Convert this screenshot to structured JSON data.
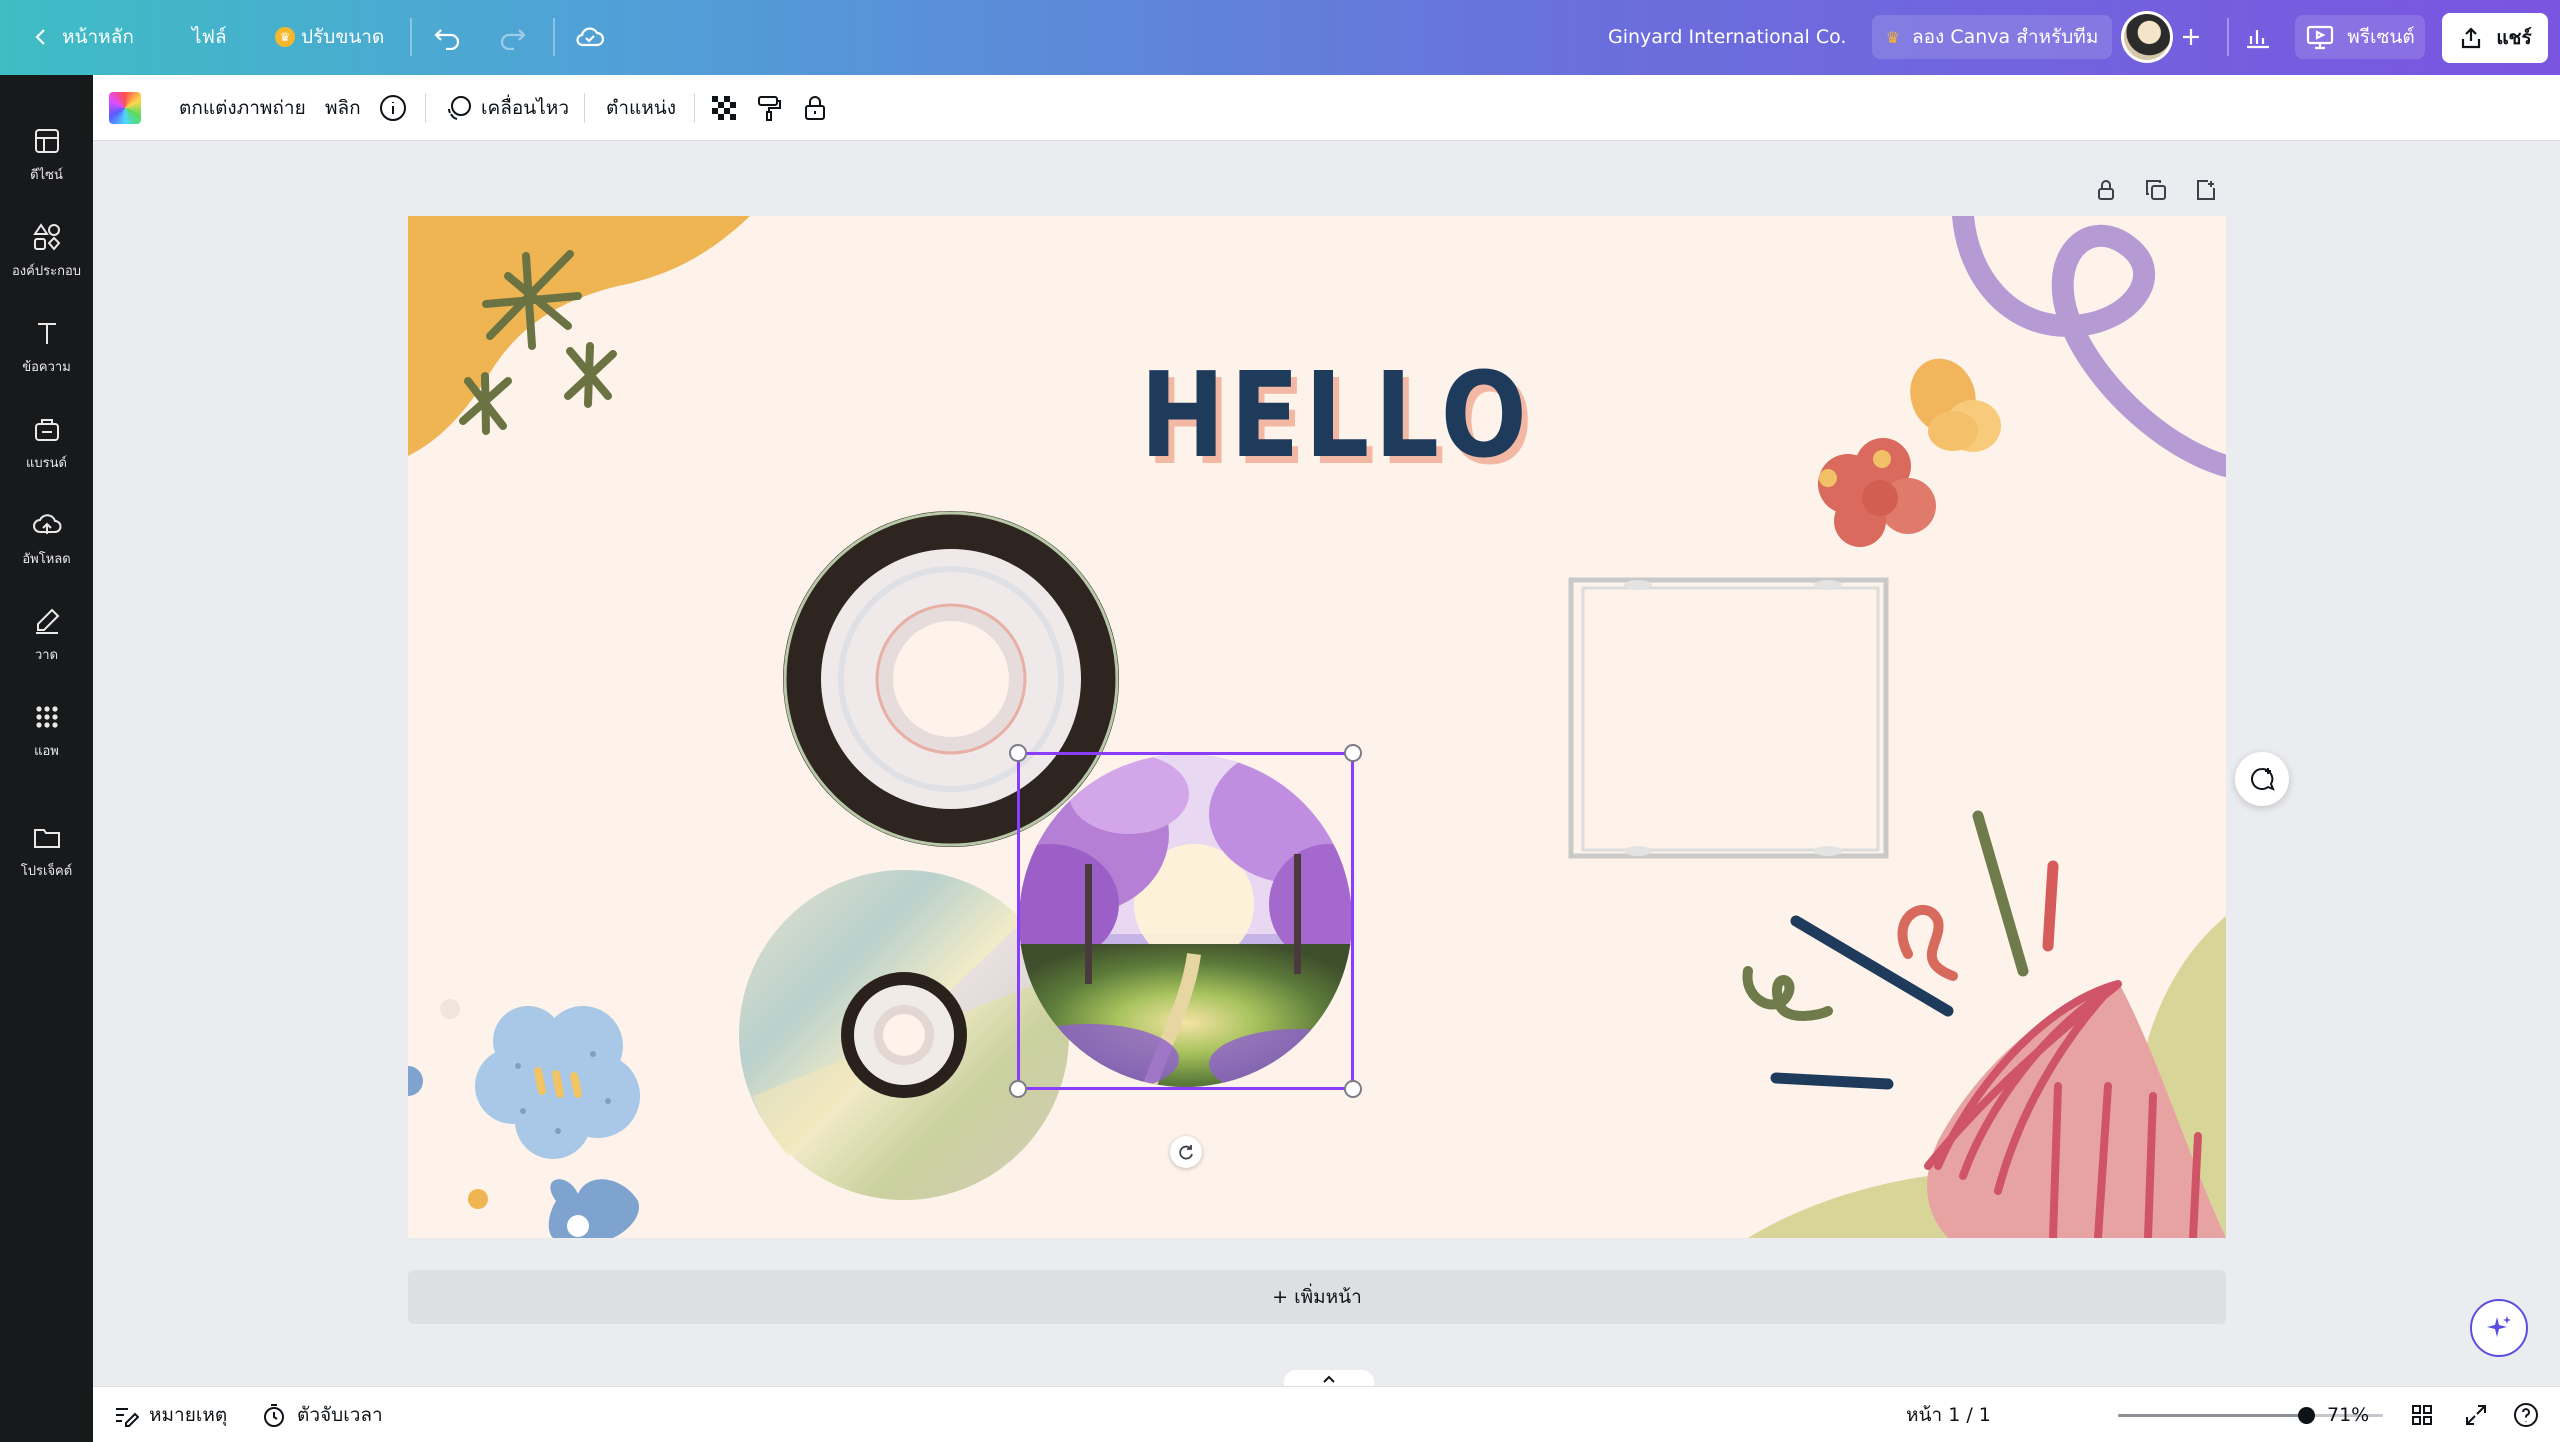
{
  "topbar": {
    "home_label": "หน้าหลัก",
    "file_label": "ไฟล์",
    "resize_label": "ปรับขนาด",
    "team_name": "Ginyard International Co.",
    "try_canva_label": "ลอง Canva สำหรับทีม",
    "present_label": "พรีเซนต์",
    "share_label": "แชร์"
  },
  "rail": {
    "items": [
      {
        "label": "ดีไซน์",
        "icon": "layout-icon"
      },
      {
        "label": "องค์ประกอบ",
        "icon": "shapes-icon"
      },
      {
        "label": "ข้อความ",
        "icon": "text-icon"
      },
      {
        "label": "แบรนด์",
        "icon": "brand-icon"
      },
      {
        "label": "อัพโหลด",
        "icon": "upload-icon"
      },
      {
        "label": "วาด",
        "icon": "draw-icon"
      },
      {
        "label": "แอพ",
        "icon": "apps-icon"
      },
      {
        "label": "โปรเจ็คต์",
        "icon": "folder-icon"
      }
    ]
  },
  "context_toolbar": {
    "edit_photo_label": "ตกแต่งภาพถ่าย",
    "flip_label": "พลิก",
    "animate_label": "เคลื่อนไหว",
    "position_label": "ตำแหน่ง"
  },
  "canvas": {
    "heading": "HELLO",
    "add_page_label": "+ เพิ่มหน้า"
  },
  "bottombar": {
    "notes_label": "หมายเหตุ",
    "timer_label": "ตัวจับเวลา",
    "page_indicator": "หน้า 1 / 1",
    "zoom_label": "71%",
    "zoom_fraction": 0.71
  },
  "colors": {
    "selection": "#8b3dff",
    "canvas_bg": "#fdf3ea",
    "heading": "#1f3b5c"
  }
}
